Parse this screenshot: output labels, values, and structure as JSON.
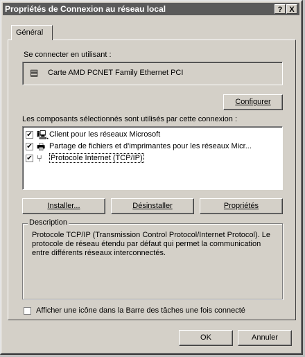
{
  "window": {
    "title": "Propriétés de Connexion au réseau local",
    "help_button": "?",
    "close_button": "X"
  },
  "tabs": [
    {
      "label": "Général"
    }
  ],
  "connect_using": {
    "label": "Se connecter en utilisant :",
    "adapter_icon": "network-adapter-icon",
    "adapter_name": "Carte AMD PCNET Family Ethernet PCI"
  },
  "configure_button": "Configurer",
  "components": {
    "label": "Les composants sélectionnés sont utilisés par cette connexion :",
    "items": [
      {
        "checked": true,
        "icon": "client-icon",
        "label": "Client pour les réseaux Microsoft",
        "selected": false
      },
      {
        "checked": true,
        "icon": "share-icon",
        "label": "Partage de fichiers et d'imprimantes pour les réseaux Micr...",
        "selected": false
      },
      {
        "checked": true,
        "icon": "protocol-icon",
        "label": "Protocole Internet (TCP/IP)",
        "selected": true
      }
    ]
  },
  "buttons": {
    "install": "Installer...",
    "uninstall": "Désinstaller",
    "properties": "Propriétés"
  },
  "description": {
    "title": "Description",
    "text": "Protocole TCP/IP (Transmission Control Protocol/Internet Protocol). Le protocole de réseau étendu par défaut qui permet la communication entre différents réseaux interconnectés."
  },
  "tray_checkbox": {
    "checked": false,
    "label": "Afficher une icône dans la Barre des tâches une fois connecté"
  },
  "footer": {
    "ok": "OK",
    "cancel": "Annuler"
  }
}
